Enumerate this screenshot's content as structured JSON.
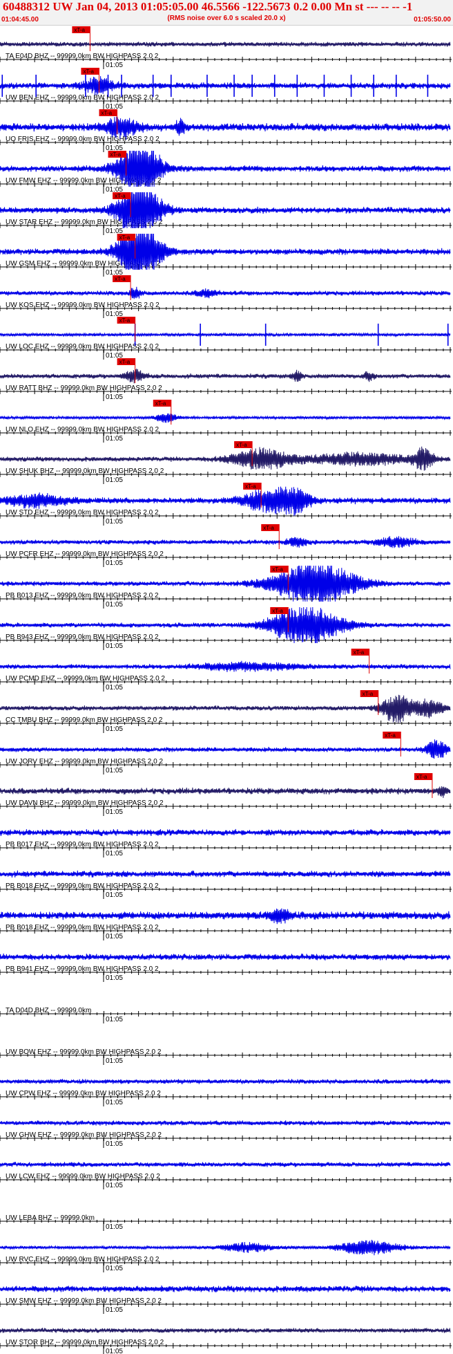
{
  "header": {
    "title": "60488312 UW Jan 04, 2013 01:05:05.00   46.5566 -122.5673  0.2 0.00 Mn st --- -- --   -1",
    "subtitle": "(RMS noise over 6.0 s scaled 20.0 x)",
    "start_time": "01:04:45.00",
    "end_time": "01:05:50.00"
  },
  "minute_label": "01:05",
  "pick_label": "xT-a",
  "colors": {
    "header_text": "#e00000",
    "trace_blue": "#0000e8",
    "trace_dark": "#221a66",
    "pick": "#e00000",
    "axis": "#000000"
  },
  "traces": [
    {
      "label": "TA E04D BHZ -- 99999.0km BW  HIGHPASS  2.0  2",
      "pick": 0.2,
      "amp": 3,
      "color": "dark",
      "bursts": []
    },
    {
      "label": "UW BEN EHZ -- 99999.0km BW  HIGHPASS  2.0  2",
      "pick": 0.22,
      "amp": 4,
      "color": "blue",
      "spikes": [
        0.005,
        0.08,
        0.19,
        0.24,
        0.27,
        0.34,
        0.38,
        0.46,
        0.52,
        0.56,
        0.61,
        0.66,
        0.72,
        0.78,
        0.83,
        0.88,
        0.95
      ],
      "bursts": [
        [
          0.22,
          0.03,
          10
        ]
      ]
    },
    {
      "label": "UO FRIS EHZ -- 99999.0km BW  HIGHPASS  2.0  2",
      "pick": 0.26,
      "amp": 5,
      "color": "blue",
      "bursts": [
        [
          0.27,
          0.03,
          14
        ],
        [
          0.4,
          0.01,
          10
        ]
      ]
    },
    {
      "label": "UW FMW EHZ -- 99999.0km BW  HIGHPASS  2.0  2",
      "pick": 0.28,
      "amp": 4,
      "color": "blue",
      "bursts": [
        [
          0.31,
          0.04,
          45
        ]
      ]
    },
    {
      "label": "UW STAR EHZ -- 99999.0km BW  HIGHPASS  2.0  2",
      "pick": 0.29,
      "amp": 4,
      "color": "blue",
      "bursts": [
        [
          0.31,
          0.04,
          45
        ]
      ]
    },
    {
      "label": "UW GSM EHZ -- 99999.0km BW  HIGHPASS  2.0  2",
      "pick": 0.3,
      "amp": 4,
      "color": "blue",
      "bursts": [
        [
          0.31,
          0.04,
          45
        ]
      ]
    },
    {
      "label": "UW KOS EHZ -- 99999.0km BW  HIGHPASS  2.0  2",
      "pick": 0.29,
      "amp": 3,
      "color": "blue",
      "bursts": [
        [
          0.3,
          0.01,
          8
        ],
        [
          0.46,
          0.02,
          5
        ]
      ]
    },
    {
      "label": "UW LOC EHZ -- 99999.0km BW  HIGHPASS  2.0  2",
      "pick": 0.3,
      "amp": 2,
      "color": "blue",
      "spikes": [
        0.3,
        0.445,
        0.59,
        0.84,
        0.995
      ],
      "bursts": []
    },
    {
      "label": "UW RATT BHZ -- 99999.0km BW  HIGHPASS  2.0  2",
      "pick": 0.3,
      "amp": 3,
      "color": "dark",
      "bursts": [
        [
          0.3,
          0.02,
          8
        ],
        [
          0.66,
          0.01,
          6
        ],
        [
          0.82,
          0.01,
          5
        ]
      ]
    },
    {
      "label": "UW NLO EHZ -- 99999.0km BW  HIGHPASS  2.0  2",
      "pick": 0.38,
      "amp": 2,
      "color": "blue",
      "bursts": [
        [
          0.37,
          0.02,
          6
        ]
      ]
    },
    {
      "label": "UW SHUK BHZ -- 99999.0km BW  HIGHPASS  2.0  2",
      "pick": 0.56,
      "amp": 3,
      "color": "dark",
      "bursts": [
        [
          0.58,
          0.06,
          14
        ],
        [
          0.8,
          0.1,
          8
        ],
        [
          0.94,
          0.02,
          14
        ]
      ]
    },
    {
      "label": "UW STD EHZ -- 99999.0km BW  HIGHPASS  2.0  2",
      "pick": 0.58,
      "amp": 4,
      "color": "blue",
      "bursts": [
        [
          0.08,
          0.06,
          8
        ],
        [
          0.6,
          0.05,
          16
        ],
        [
          0.66,
          0.03,
          12
        ]
      ]
    },
    {
      "label": "UW PCFR EHZ -- 99999.0km BW  HIGHPASS  2.0  2",
      "pick": 0.62,
      "amp": 3,
      "color": "blue",
      "bursts": [
        [
          0.66,
          0.02,
          6
        ],
        [
          0.88,
          0.04,
          6
        ]
      ]
    },
    {
      "label": "PB B013 EHZ -- 99999.0km BW  HIGHPASS  2.0  2",
      "pick": 0.64,
      "amp": 3,
      "color": "blue",
      "bursts": [
        [
          0.7,
          0.08,
          32
        ]
      ]
    },
    {
      "label": "PB B943 EHZ -- 99999.0km BW  HIGHPASS  2.0  2",
      "pick": 0.64,
      "amp": 3,
      "color": "blue",
      "bursts": [
        [
          0.68,
          0.07,
          28
        ]
      ]
    },
    {
      "label": "UW PCMD EHZ -- 99999.0km BW  HIGHPASS  2.0  2",
      "pick": 0.82,
      "amp": 3,
      "color": "blue",
      "bursts": [
        [
          0.55,
          0.1,
          5
        ]
      ]
    },
    {
      "label": "CC TMBU BHZ -- 99999.0km BW  HIGHPASS  2.0  2",
      "pick": 0.84,
      "amp": 3,
      "color": "dark",
      "bursts": [
        [
          0.88,
          0.03,
          20
        ],
        [
          0.95,
          0.03,
          12
        ]
      ]
    },
    {
      "label": "UW JORV EHZ -- 99999.0km BW  HIGHPASS  2.0  2",
      "pick": 0.89,
      "amp": 3,
      "color": "blue",
      "bursts": [
        [
          0.97,
          0.02,
          14
        ]
      ]
    },
    {
      "label": "UW DAVN BHZ -- 99999.0km BW  HIGHPASS  2.0  2",
      "pick": 0.96,
      "amp": 4,
      "color": "dark",
      "bursts": [
        [
          0.98,
          0.01,
          6
        ]
      ]
    },
    {
      "label": "PB B017 EHZ -- 99999.0km BW  HIGHPASS  2.0  2",
      "pick": null,
      "amp": 4,
      "color": "blue",
      "bursts": []
    },
    {
      "label": "PB B018 EHZ -- 99999.0km BW  HIGHPASS  2.0  2",
      "pick": null,
      "amp": 4,
      "color": "blue",
      "bursts": []
    },
    {
      "label": "PB B018 EHZ -- 99999.0km BW  HIGHPASS  2.0  2",
      "pick": null,
      "amp": 5,
      "color": "blue",
      "bursts": [
        [
          0.62,
          0.02,
          8
        ]
      ]
    },
    {
      "label": "PB B941 EHZ -- 99999.0km BW  HIGHPASS  2.0  2",
      "pick": null,
      "amp": 4,
      "color": "blue",
      "bursts": []
    },
    {
      "label": "TA D04D BHZ -- 99999.0km",
      "pick": null,
      "amp": 0,
      "color": "blue",
      "bursts": []
    },
    {
      "label": "UW BOW EHZ -- 99999.0km BW  HIGHPASS  2.0  2",
      "pick": null,
      "amp": 0,
      "color": "blue",
      "bursts": []
    },
    {
      "label": "UW CPW EHZ -- 99999.0km BW  HIGHPASS  2.0  2",
      "pick": null,
      "amp": 3,
      "color": "blue",
      "bursts": []
    },
    {
      "label": "UW GHW EHZ -- 99999.0km BW  HIGHPASS  2.0  2",
      "pick": null,
      "amp": 3,
      "color": "blue",
      "bursts": []
    },
    {
      "label": "UW LCW EHZ -- 99999.0km BW  HIGHPASS  2.0  2",
      "pick": null,
      "amp": 3,
      "color": "blue",
      "bursts": []
    },
    {
      "label": "UW LEBA BHZ -- 99999.0km",
      "pick": null,
      "amp": 0,
      "color": "blue",
      "bursts": []
    },
    {
      "label": "UW RVC EHZ -- 99999.0km BW  HIGHPASS  2.0  2",
      "pick": null,
      "amp": 2,
      "color": "blue",
      "bursts": [
        [
          0.55,
          0.05,
          6
        ],
        [
          0.82,
          0.06,
          10
        ]
      ]
    },
    {
      "label": "UW SMW EHZ -- 99999.0km BW  HIGHPASS  2.0  2",
      "pick": null,
      "amp": 4,
      "color": "blue",
      "bursts": []
    },
    {
      "label": "UW STOR BHZ -- 99999.0km BW  HIGHPASS  2.0  2",
      "pick": null,
      "amp": 3,
      "color": "dark",
      "bursts": []
    }
  ]
}
